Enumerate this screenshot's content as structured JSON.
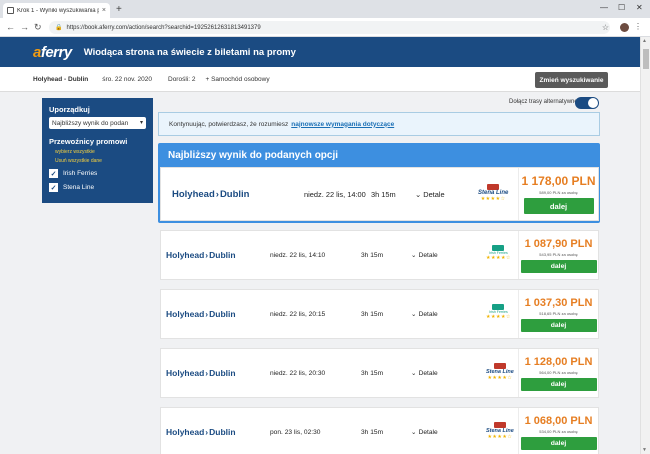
{
  "browser": {
    "tab_title": "Krok 1 - Wyniki wyszukiwania p...",
    "tab_close": "×",
    "new_tab": "+",
    "url": "https://book.aferry.com/action/search?searchid=1925261263181349137​9",
    "nav": {
      "back": "←",
      "forward": "→",
      "reload": "↻"
    },
    "window_controls": {
      "minimize": "—",
      "maximize": "☐",
      "close": "✕"
    }
  },
  "header": {
    "logo_a": "a",
    "logo_rest": "ferry",
    "tagline": "Wiodąca strona na świecie z biletami na promy"
  },
  "summary": {
    "route": "Holyhead - Dublin",
    "date": "śro. 22 nov. 2020",
    "passengers": "Dorośli: 2",
    "vehicle": "+ Samochód osobowy",
    "change_button": "Zmień wyszukiwanie"
  },
  "filters": {
    "sort_title": "Uporządkuj",
    "sort_value": "Najbliższy wynik do podan",
    "operators_title": "Przewoźnicy promowi",
    "select_all": "wybierz wszystkie",
    "deselect_all": "Usuń wszystkie dane",
    "operators": [
      {
        "name": "Irish Ferries",
        "checked": true
      },
      {
        "name": "Stena Line",
        "checked": true
      }
    ]
  },
  "alt_routes_label": "Dołącz trasy alternatywne",
  "alt_routes_enabled": true,
  "notice": {
    "text": "Kontynuując, potwierdzasz, że rozumiesz",
    "link": "najnowsze wymagania dotyczące"
  },
  "best_title": "Najbliższy wynik do podanych opcji",
  "results": [
    {
      "from": "Holyhead",
      "to": "Dublin",
      "datetime": "niedz. 22 lis, 14:00",
      "duration": "3h 15m",
      "details": "Detale",
      "operator": "Stena Line",
      "stars": "★★★★☆",
      "price": "1 178,00 PLN",
      "per_person": "589,00 PLN za osobę",
      "button": "dalej"
    },
    {
      "from": "Holyhead",
      "to": "Dublin",
      "datetime": "niedz. 22 lis, 14:10",
      "duration": "3h 15m",
      "details": "Detale",
      "operator": "Irish Ferries",
      "stars": "★★★★☆",
      "price": "1 087,90 PLN",
      "per_person": "543,95 PLN za osobę",
      "button": "dalej"
    },
    {
      "from": "Holyhead",
      "to": "Dublin",
      "datetime": "niedz. 22 lis, 20:15",
      "duration": "3h 15m",
      "details": "Detale",
      "operator": "Irish Ferries",
      "stars": "★★★★☆",
      "price": "1 037,30 PLN",
      "per_person": "518,65 PLN za osobę",
      "button": "dalej"
    },
    {
      "from": "Holyhead",
      "to": "Dublin",
      "datetime": "niedz. 22 lis, 20:30",
      "duration": "3h 15m",
      "details": "Detale",
      "operator": "Stena Line",
      "stars": "★★★★☆",
      "price": "1 128,00 PLN",
      "per_person": "564,00 PLN za osobę",
      "button": "dalej"
    },
    {
      "from": "Holyhead",
      "to": "Dublin",
      "datetime": "pon. 23 lis, 02:30",
      "duration": "3h 15m",
      "details": "Detale",
      "operator": "Stena Line",
      "stars": "★★★★☆",
      "price": "1 068,00 PLN",
      "per_person": "534,00 PLN za osobę",
      "button": "dalej"
    }
  ],
  "colors": {
    "brand_blue": "#1b4b82",
    "accent_orange": "#e67e22",
    "button_green": "#2e9e3e",
    "best_blue": "#3d8fe0"
  }
}
